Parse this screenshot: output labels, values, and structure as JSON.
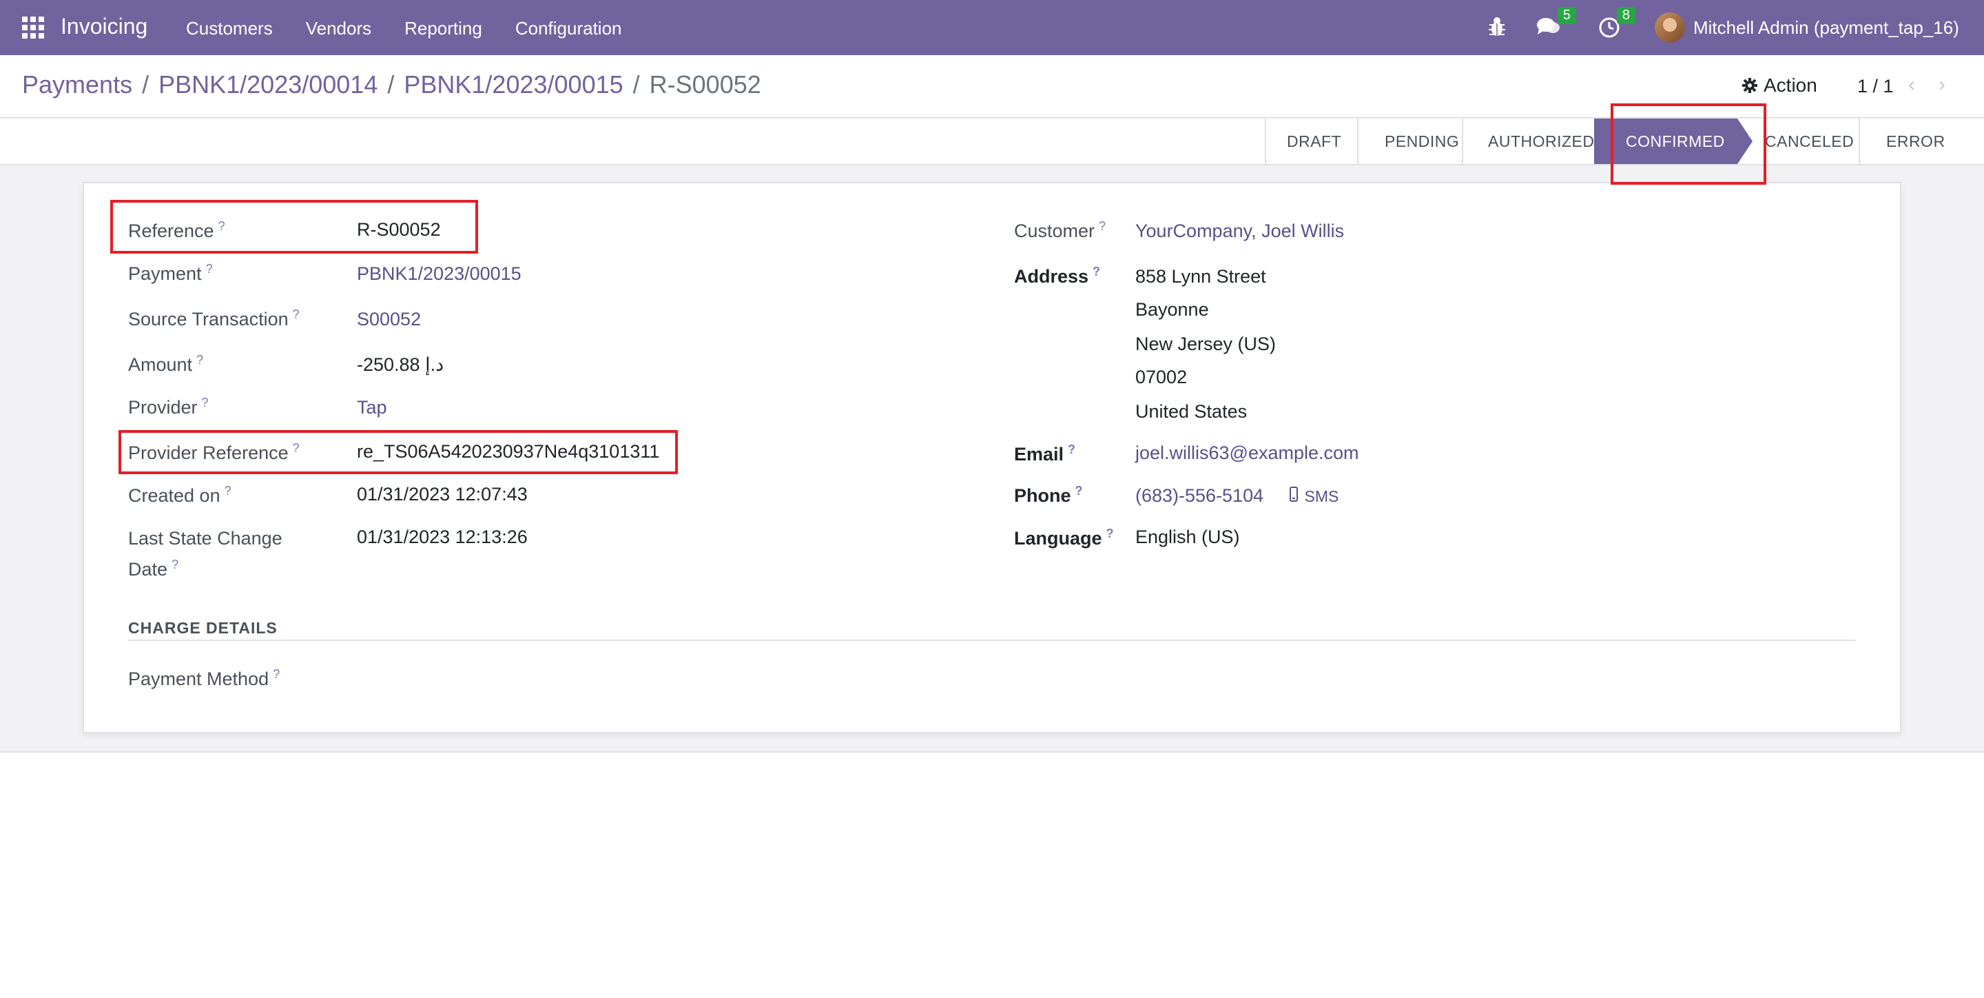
{
  "navbar": {
    "app_name": "Invoicing",
    "menu": [
      "Customers",
      "Vendors",
      "Reporting",
      "Configuration"
    ],
    "messages_count": "5",
    "activities_count": "8",
    "user": "Mitchell Admin (payment_tap_16)"
  },
  "breadcrumb": {
    "items": [
      "Payments",
      "PBNK1/2023/00014",
      "PBNK1/2023/00015"
    ],
    "separator": "/",
    "current": "R-S00052"
  },
  "control": {
    "action_label": "Action",
    "pager": "1 / 1"
  },
  "statusbar": {
    "states": [
      "DRAFT",
      "PENDING",
      "AUTHORIZED",
      "CONFIRMED",
      "CANCELED",
      "ERROR"
    ],
    "active": "CONFIRMED"
  },
  "form": {
    "left": {
      "reference_label": "Reference",
      "reference_value": "R-S00052",
      "payment_label": "Payment",
      "payment_value": "PBNK1/2023/00015",
      "source_label": "Source Transaction",
      "source_value": "S00052",
      "amount_label": "Amount",
      "amount_value": "-250.88 د.إ",
      "provider_label": "Provider",
      "provider_value": "Tap",
      "provider_ref_label": "Provider Reference",
      "provider_ref_value": "re_TS06A5420230937Ne4q3101311",
      "created_label": "Created on",
      "created_value": "01/31/2023 12:07:43",
      "last_state_label_1": "Last State Change",
      "last_state_label_2": "Date",
      "last_state_value": "01/31/2023 12:13:26"
    },
    "right": {
      "customer_label": "Customer",
      "customer_value": "YourCompany, Joel Willis",
      "address_label": "Address",
      "address_lines": [
        "858 Lynn Street",
        "Bayonne",
        "New Jersey (US)",
        "07002",
        "United States"
      ],
      "email_label": "Email",
      "email_value": "joel.willis63@example.com",
      "phone_label": "Phone",
      "phone_value": "(683)-556-5104",
      "sms_label": "SMS",
      "language_label": "Language",
      "language_value": "English (US)"
    },
    "charge_details_title": "CHARGE DETAILS",
    "payment_method_label": "Payment Method",
    "help_mark": "?"
  },
  "colors": {
    "brand": "#71639e",
    "link": "#5a4f8a",
    "highlight": "#e51e25",
    "badge": "#28a745"
  }
}
